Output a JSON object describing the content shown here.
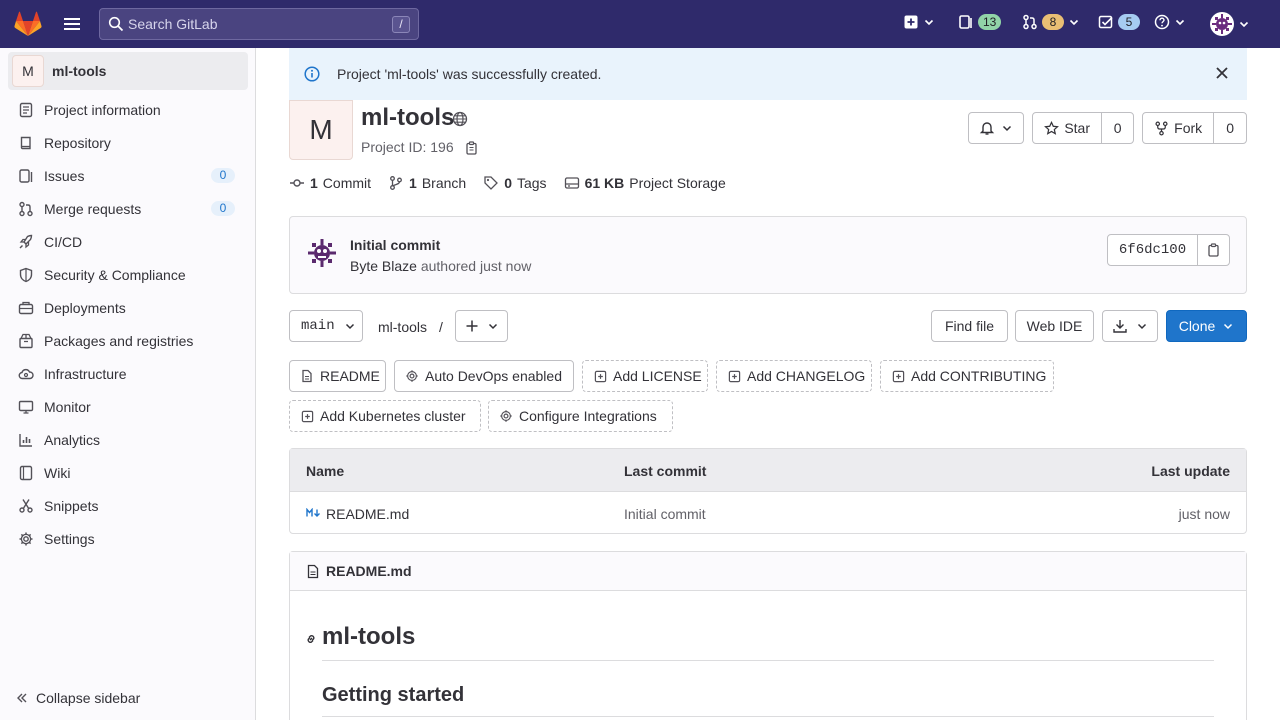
{
  "topbar": {
    "search_placeholder": "Search GitLab",
    "search_shortcut": "/",
    "issues_count": "13",
    "mr_count": "8",
    "todos_count": "5"
  },
  "sidebar": {
    "project_initial": "M",
    "project_name": "ml-tools",
    "items": [
      {
        "label": "Project information",
        "icon": "info-icon"
      },
      {
        "label": "Repository",
        "icon": "repository-icon"
      },
      {
        "label": "Issues",
        "icon": "issues-icon",
        "count": "0"
      },
      {
        "label": "Merge requests",
        "icon": "merge-request-icon",
        "count": "0"
      },
      {
        "label": "CI/CD",
        "icon": "rocket-icon"
      },
      {
        "label": "Security & Compliance",
        "icon": "shield-icon"
      },
      {
        "label": "Deployments",
        "icon": "deployments-icon"
      },
      {
        "label": "Packages and registries",
        "icon": "package-icon"
      },
      {
        "label": "Infrastructure",
        "icon": "cloud-icon"
      },
      {
        "label": "Monitor",
        "icon": "monitor-icon"
      },
      {
        "label": "Analytics",
        "icon": "chart-icon"
      },
      {
        "label": "Wiki",
        "icon": "book-icon"
      },
      {
        "label": "Snippets",
        "icon": "snippet-icon"
      },
      {
        "label": "Settings",
        "icon": "gear-icon"
      }
    ],
    "collapse_label": "Collapse sidebar"
  },
  "alert": {
    "text": "Project 'ml-tools' was successfully created."
  },
  "project": {
    "initial": "M",
    "name": "ml-tools",
    "id_text": "Project ID: 196",
    "star_label": "Star",
    "star_count": "0",
    "fork_label": "Fork",
    "fork_count": "0"
  },
  "stats": {
    "commits_num": "1",
    "commits_label": "Commit",
    "branches_num": "1",
    "branches_label": "Branch",
    "tags_num": "0",
    "tags_label": "Tags",
    "storage_num": "61 KB",
    "storage_label": "Project Storage"
  },
  "commit": {
    "title": "Initial commit",
    "author": "Byte Blaze",
    "meta": "authored just now",
    "sha": "6f6dc100"
  },
  "repo_toolbar": {
    "branch": "main",
    "path": "ml-tools",
    "path_sep": "/",
    "find_file": "Find file",
    "web_ide": "Web IDE",
    "clone": "Clone"
  },
  "shortcuts": {
    "readme": "README",
    "auto_devops": "Auto DevOps enabled",
    "add_license": "Add LICENSE",
    "add_changelog": "Add CHANGELOG",
    "add_contributing": "Add CONTRIBUTING",
    "add_kubernetes": "Add Kubernetes cluster",
    "configure_integrations": "Configure Integrations"
  },
  "files_table": {
    "headers": {
      "name": "Name",
      "last_commit": "Last commit",
      "last_update": "Last update"
    },
    "rows": [
      {
        "name": "README.md",
        "last_commit": "Initial commit",
        "last_update": "just now"
      }
    ]
  },
  "readme": {
    "filename": "README.md",
    "h1": "ml-tools",
    "h2": "Getting started"
  },
  "colors": {
    "topbar": "#2f2a6b",
    "primary_button": "#1f75cb",
    "alert_bg": "#e9f3fc"
  }
}
